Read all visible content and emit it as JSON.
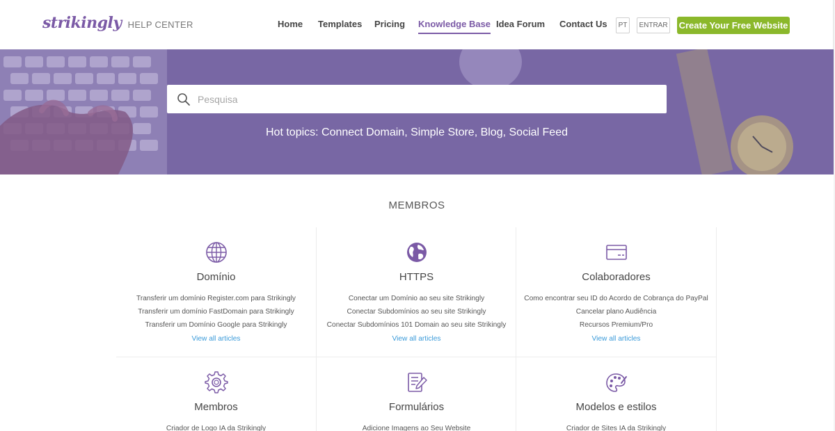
{
  "header": {
    "logo_word": "strikingly",
    "logo_sub": "HELP CENTER",
    "nav": [
      {
        "label": "Home"
      },
      {
        "label": "Templates"
      },
      {
        "label": "Pricing"
      },
      {
        "label": "Knowledge Base"
      },
      {
        "label": "Idea Forum"
      },
      {
        "label": "Contact Us"
      }
    ],
    "lang_button": "PT",
    "login_button": "ENTRAR",
    "cta_label": "Create Your Free Website"
  },
  "hero": {
    "search_placeholder": "Pesquisa",
    "hot_topics": "Hot topics: Connect Domain, Simple Store, Blog, Social Feed"
  },
  "section": {
    "title": "MEMBROS",
    "cards": [
      {
        "icon": "globe-icon",
        "title": "Domínio",
        "links": [
          "Transferir um domínio Register.com para Strikingly",
          "Transferir um domínio FastDomain para Strikingly",
          "Transferir um Domínio Google para Strikingly"
        ],
        "view_all": "View all articles"
      },
      {
        "icon": "earth-icon",
        "title": "HTTPS",
        "links": [
          "Conectar um Domínio ao seu site Strikingly",
          "Conectar Subdomínios ao seu site Strikingly",
          "Conectar Subdomínios 101 Domain ao seu site Strikingly"
        ],
        "view_all": "View all articles"
      },
      {
        "icon": "credit-card-icon",
        "title": "Colaboradores",
        "links": [
          "Como encontrar seu ID do Acordo de Cobrança do PayPal",
          "Cancelar plano Audiência",
          "Recursos Premium/Pro"
        ],
        "view_all": "View all articles"
      },
      {
        "icon": "gear-icon",
        "title": "Membros",
        "links": [
          "Criador de Logo IA da Strikingly"
        ],
        "view_all": ""
      },
      {
        "icon": "form-edit-icon",
        "title": "Formulários",
        "links": [
          "Adicione Imagens ao Seu Website"
        ],
        "view_all": ""
      },
      {
        "icon": "palette-icon",
        "title": "Modelos e estilos",
        "links": [
          "Criador de Sites IA da Strikingly"
        ],
        "view_all": ""
      }
    ]
  },
  "colors": {
    "brand": "#7b5aa6",
    "cta": "#8bb82b",
    "link": "#3a9ad9",
    "hero_overlay": "#7f6ea8"
  }
}
